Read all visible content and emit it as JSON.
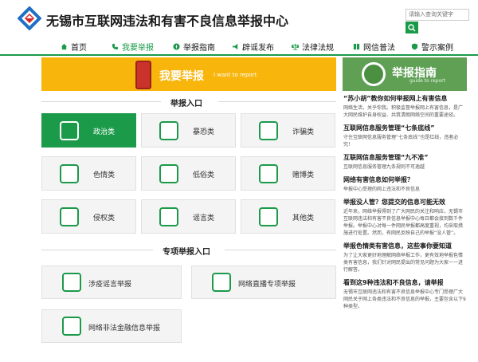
{
  "header": {
    "site_title": "无锡市互联网违法和有害不良信息举报中心",
    "search_placeholder": "请输入查询关键字"
  },
  "nav": [
    {
      "label": "首页",
      "icon": "home-icon"
    },
    {
      "label": "我要举报",
      "icon": "phone-icon",
      "active": true
    },
    {
      "label": "举报指南",
      "icon": "compass-icon"
    },
    {
      "label": "辟谣发布",
      "icon": "megaphone-icon"
    },
    {
      "label": "法律法规",
      "icon": "scales-icon"
    },
    {
      "label": "网信普法",
      "icon": "book-icon"
    },
    {
      "label": "警示案例",
      "icon": "shield-icon"
    }
  ],
  "report_banner": {
    "title": "我要举报",
    "subtitle": "I want to report"
  },
  "guide_banner": {
    "title": "举报指南",
    "subtitle": "guide to report"
  },
  "report_entry": {
    "title": "举报入口",
    "tiles": [
      {
        "label": "政治类",
        "icon": "politics-icon",
        "active": true
      },
      {
        "label": "暴恐类",
        "icon": "bomb-icon"
      },
      {
        "label": "诈骗类",
        "icon": "fraud-icon"
      },
      {
        "label": "色情类",
        "icon": "pornography-icon"
      },
      {
        "label": "低俗类",
        "icon": "vulgar-icon"
      },
      {
        "label": "赌博类",
        "icon": "gambling-icon"
      },
      {
        "label": "侵权类",
        "icon": "infringement-icon"
      },
      {
        "label": "谣言类",
        "icon": "rumor-icon"
      },
      {
        "label": "其他类",
        "icon": "other-icon"
      }
    ]
  },
  "special_entry": {
    "title": "专项举报入口",
    "tiles": [
      {
        "label": "涉疫谣言举报",
        "icon": "epidemic-shield-icon"
      },
      {
        "label": "网络直播专项举报",
        "icon": "livestream-icon"
      },
      {
        "label": "网络非法金融信息举报",
        "icon": "finance-prohibited-icon"
      }
    ]
  },
  "guide_items": [
    {
      "title": "“苏小胡”教你如何举报网上有害信息",
      "desc": "网络生活，关乎你我。积极监督举报网上有害信息，是广大网民维护自身权益、共筑清朗网络空间的重要途径。"
    },
    {
      "title": "互联网信息服务管理“七条底线”",
      "desc": "守住互联网信息服务管理“七条底线”也是红线，违者必究！"
    },
    {
      "title": "互联网信息服务管理“九不准”",
      "desc": "互联网信息服务管理九条规则不可逾越"
    },
    {
      "title": "网络有害信息如何举报？",
      "desc": "举报中心受理的网上违法和不良信息"
    },
    {
      "title": "举报没人管？您提交的信息可能无效",
      "desc": "近年来，网络举报得到了广大网民的关注和响应，无锡市互联网违法和有害不良信息举报中心每日都会接到数千件举报。举报中心对每一件网民举报都高度重视，均采取措施进行处置。然而，有网民反映自己的举报“没人管”。"
    },
    {
      "title": "举报色情类有害信息，这些事你要知道",
      "desc": "为了让大家更好地理解网络举报工作，更有效地举报色情类有害信息，我们针对网民提出的常见问题为大家一一进行解答。"
    },
    {
      "title": "看到这9种违法和不良信息，请举报",
      "desc": "无锡市互联网违法和有害不良信息举报中心专门受理广大网民关于网上各类违法和不良信息的举报，主要包含以下9种类型。"
    }
  ],
  "colors": {
    "brand_green": "#1b9a4a",
    "banner_yellow": "#f8b60d",
    "guide_green": "#5fa055",
    "logo_red": "#d6262b",
    "logo_blue": "#1f6fc4"
  }
}
